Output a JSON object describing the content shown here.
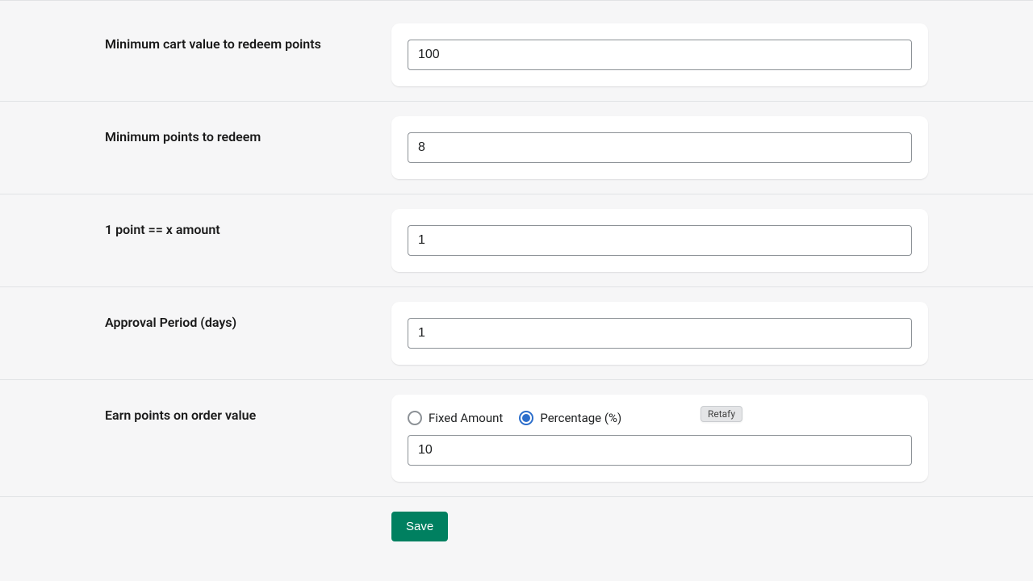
{
  "rows": {
    "min_cart": {
      "label": "Minimum cart value to redeem points",
      "value": "100"
    },
    "min_points": {
      "label": "Minimum points to redeem",
      "value": "8"
    },
    "point_amount": {
      "label": "1 point == x amount",
      "value": "1"
    },
    "approval": {
      "label": "Approval Period (days)",
      "value": "1"
    },
    "earn": {
      "label": "Earn points on order value",
      "fixed_label": "Fixed Amount",
      "percentage_label": "Percentage (%)",
      "value": "10",
      "tooltip": "Retafy",
      "selected": "percentage"
    }
  },
  "actions": {
    "save": "Save"
  }
}
